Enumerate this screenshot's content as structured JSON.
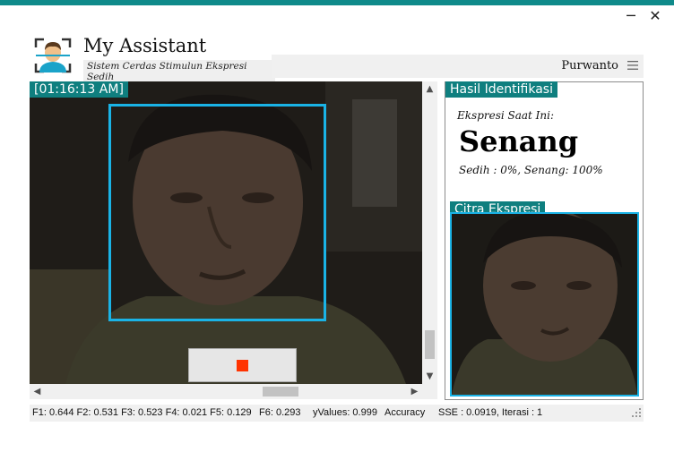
{
  "window": {
    "minimize_glyph": "─",
    "close_glyph": "✕",
    "accent_color": "#0f8a8a"
  },
  "header": {
    "title": "My Assistant",
    "subtitle": "Sistem Cerdas Stimulun Ekspresi Sedih",
    "user_name": "Purwanto",
    "logo_icon": "face-scan-icon",
    "menu_icon": "hamburger-menu-icon"
  },
  "camera": {
    "timestamp": "[01:16:13 AM]",
    "face_box_color": "#1ab3e6",
    "stop_icon": "stop-icon",
    "stop_color": "#ff3300"
  },
  "identification": {
    "tag": "Hasil Identifikasi",
    "current_label": "Ekspresi Saat Ini:",
    "current_value": "Senang",
    "detail": "Sedih : 0%, Senang: 100%"
  },
  "citra": {
    "tag": "Citra Ekspresi"
  },
  "status": {
    "features": "F1: 0.644 F2: 0.531 F3: 0.523 F4: 0.021 F5: 0.129",
    "f6": "F6: 0.293",
    "yvalues": "yValues: 0.999",
    "accuracy": "Accuracy",
    "sse": "SSE : 0.0919, Iterasi : 1"
  }
}
